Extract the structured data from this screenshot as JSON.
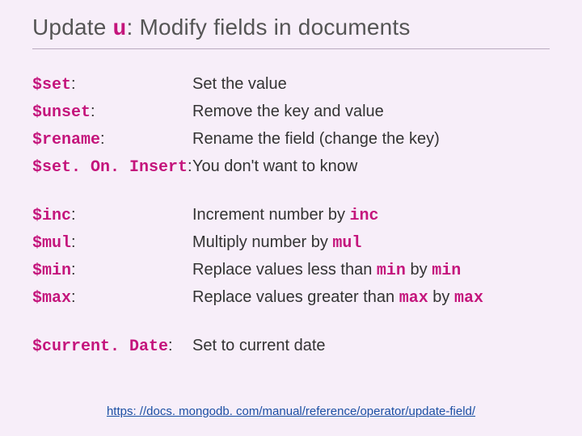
{
  "title": {
    "pre": "Update ",
    "code": "u",
    "post": ": Modify fields in documents"
  },
  "groups": [
    {
      "rows": [
        {
          "op": "$set",
          "desc_parts": [
            {
              "t": "Set the value"
            }
          ]
        },
        {
          "op": "$unset",
          "desc_parts": [
            {
              "t": "Remove the key and value"
            }
          ]
        },
        {
          "op": "$rename",
          "desc_parts": [
            {
              "t": "Rename the field (change the key)"
            }
          ]
        },
        {
          "op": "$set. On. Insert",
          "desc_parts": [
            {
              "t": "You don't want to know"
            }
          ]
        }
      ]
    },
    {
      "rows": [
        {
          "op": "$inc",
          "desc_parts": [
            {
              "t": "Increment number by "
            },
            {
              "c": "inc"
            }
          ]
        },
        {
          "op": "$mul",
          "desc_parts": [
            {
              "t": "Multiply number by "
            },
            {
              "c": "mul"
            }
          ]
        },
        {
          "op": "$min",
          "desc_parts": [
            {
              "t": "Replace values less than "
            },
            {
              "c": "min"
            },
            {
              "t": " by "
            },
            {
              "c": "min"
            }
          ]
        },
        {
          "op": "$max",
          "desc_parts": [
            {
              "t": "Replace values greater than "
            },
            {
              "c": "max"
            },
            {
              "t": " by "
            },
            {
              "c": "max"
            }
          ]
        }
      ]
    },
    {
      "rows": [
        {
          "op": "$current. Date",
          "desc_parts": [
            {
              "t": "Set to current date"
            }
          ]
        }
      ]
    }
  ],
  "link": {
    "text": "https: //docs. mongodb. com/manual/reference/operator/update-field/",
    "href": "https://docs.mongodb.com/manual/reference/operator/update-field/"
  }
}
